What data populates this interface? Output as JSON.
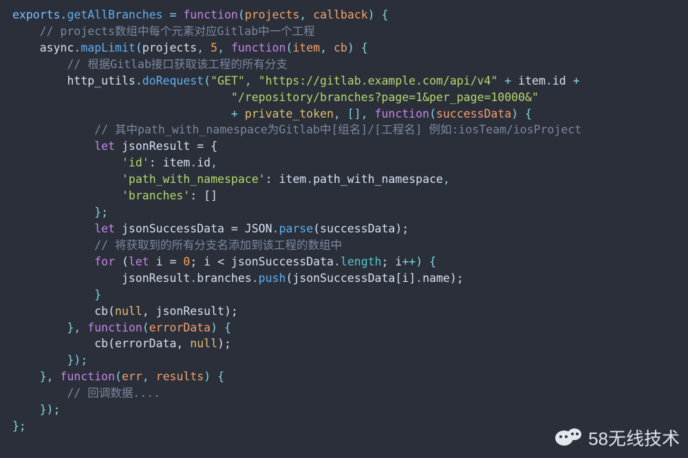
{
  "code": {
    "L1": {
      "a": "exports",
      "b": ".",
      "c": "getAllBranches",
      "d": " = ",
      "e": "function",
      "f": "(",
      "g": "projects",
      "h": ", ",
      "i": "callback",
      "j": ") {"
    },
    "L2": {
      "a": "    ",
      "b": "// projects数组中每个元素对应Gitlab中一个工程"
    },
    "L3": {
      "a": "    async",
      "b": ".",
      "c": "mapLimit",
      "d": "(",
      "e": "projects",
      "f": ", ",
      "g": "5",
      "h": ", ",
      "i": "function",
      "j": "(",
      "k": "item",
      "l": ", ",
      "m": "cb",
      "n": ") {"
    },
    "L4": {
      "a": "        ",
      "b": "// 根据Gitlab接口获取该工程的所有分支"
    },
    "L5": {
      "a": "        http_utils",
      "b": ".",
      "c": "doRequest",
      "d": "(",
      "e": "\"GET\"",
      "f": ", ",
      "g": "\"https://gitlab.example.com/api/v4\"",
      "h": " + ",
      "i": "item",
      "j": ".",
      "k": "id",
      "l": " +"
    },
    "L6": {
      "a": "                                ",
      "b": "\"/repository/branches?page=1&per_page=10000&\""
    },
    "L7": {
      "a": "                                + ",
      "b": "private_token",
      "c": ", [], ",
      "d": "function",
      "e": "(",
      "f": "successData",
      "g": ") {"
    },
    "L8": {
      "a": "            ",
      "b": "// 其中path_with_namespace为Gitlab中[组名]/[工程名] 例如:iosTeam/iosProject"
    },
    "L9": {
      "a": "            ",
      "b": "let",
      "c": " jsonResult = {"
    },
    "L10": {
      "a": "                ",
      "b": "'id'",
      "c": ": item",
      "d": ".",
      "e": "id",
      "f": ","
    },
    "L11": {
      "a": "                ",
      "b": "'path_with_namespace'",
      "c": ": item",
      "d": ".",
      "e": "path_with_namespace",
      "f": ","
    },
    "L12": {
      "a": "                ",
      "b": "'branches'",
      "c": ": []"
    },
    "L13": {
      "a": "            };"
    },
    "L14": {
      "a": "            ",
      "b": "let",
      "c": " jsonSuccessData = JSON",
      "d": ".",
      "e": "parse",
      "f": "(successData);"
    },
    "L15": {
      "a": "            ",
      "b": "// 将获取到的所有分支名添加到该工程的数组中"
    },
    "L16": {
      "a": "            ",
      "b": "for",
      "c": " (",
      "d": "let",
      "e": " i = ",
      "f": "0",
      "g": "; i < jsonSuccessData",
      "h": ".",
      "i": "length",
      "j": "; i",
      "k": "++",
      "l": ") {"
    },
    "L17": {
      "a": "                jsonResult",
      "b": ".",
      "c": "branches",
      "d": ".",
      "e": "push",
      "f": "(jsonSuccessData[i]",
      "g": ".",
      "h": "name",
      "i": ");"
    },
    "L18": {
      "a": "            }"
    },
    "L19": {
      "a": "            cb(",
      "b": "null",
      "c": ", jsonResult);"
    },
    "L20": {
      "a": "        }, ",
      "b": "function",
      "c": "(",
      "d": "errorData",
      "e": ") {"
    },
    "L21": {
      "a": "            cb(errorData, ",
      "b": "null",
      "c": ");"
    },
    "L22": {
      "a": "        });"
    },
    "L23": {
      "a": "    }, ",
      "b": "function",
      "c": "(",
      "d": "err",
      "e": ", ",
      "f": "results",
      "g": ") {"
    },
    "L24": {
      "a": "        ",
      "b": "// 回调数据...."
    },
    "L25": {
      "a": "    });"
    },
    "L26": {
      "a": "};"
    }
  },
  "watermark": "58无线技术"
}
